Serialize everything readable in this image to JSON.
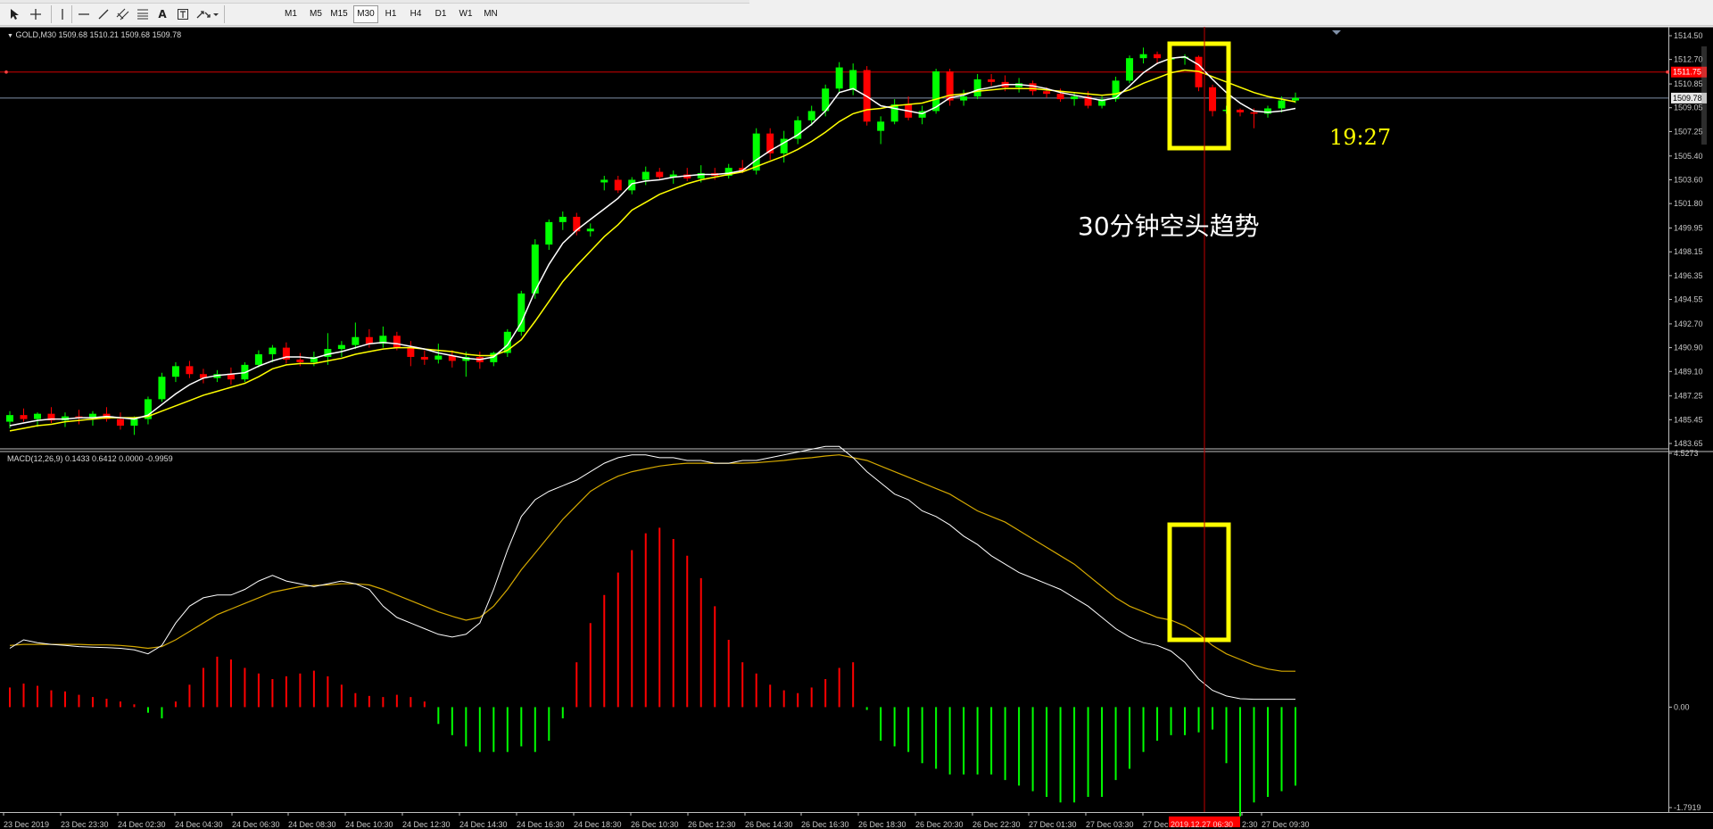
{
  "toolbar": {
    "tools": [
      "cursor-icon",
      "crosshair-icon",
      "vertical-line-icon",
      "horizontal-line-icon",
      "trendline-icon",
      "channel-icon",
      "fibonacci-icon",
      "text-icon",
      "text-label-icon",
      "arrows-icon"
    ],
    "text_tool_label": "A",
    "timeframes": [
      "M1",
      "M5",
      "M15",
      "M30",
      "H1",
      "H4",
      "D1",
      "W1",
      "MN"
    ],
    "active_timeframe": "M30"
  },
  "chart_header": {
    "label": "GOLD,M30  1509.68 1510.21 1509.68 1509.78"
  },
  "macd_header": {
    "label": "MACD(12,26,9) 0.1433 0.6412 0.0000 -0.9959"
  },
  "price_axis": [
    "1514.50",
    "1512.70",
    "1510.85",
    "1509.05",
    "1507.25",
    "1505.40",
    "1503.60",
    "1501.80",
    "1499.95",
    "1498.15",
    "1496.35",
    "1494.55",
    "1492.70",
    "1490.90",
    "1489.10",
    "1487.25",
    "1485.45",
    "1483.65"
  ],
  "current_price_tag": "1509.78",
  "red_line_tag": "1511.75",
  "macd_axis": [
    "4.5273",
    "0.00",
    "-1.7919"
  ],
  "time_axis": [
    "23 Dec 2019",
    "23 Dec 23:30",
    "24 Dec 02:30",
    "24 Dec 04:30",
    "24 Dec 06:30",
    "24 Dec 08:30",
    "24 Dec 10:30",
    "24 Dec 12:30",
    "24 Dec 14:30",
    "24 Dec 16:30",
    "24 Dec 18:30",
    "26 Dec 10:30",
    "26 Dec 12:30",
    "26 Dec 14:30",
    "26 Dec 16:30",
    "26 Dec 18:30",
    "26 Dec 20:30",
    "26 Dec 22:30",
    "27 Dec 01:30",
    "27 Dec 03:30",
    "27 Dec",
    "2:30",
    "27 Dec 09:30"
  ],
  "cursor_time_tag": "2019.12.27 06:30",
  "countdown": "19:27",
  "annotation": "30分钟空头趋势",
  "colors": {
    "bull": "#00ff00",
    "bear": "#ff0000",
    "ma_fast": "#ffffff",
    "ma_slow": "#ffff00",
    "highlight": "#ffff00",
    "grid_text": "#c8c8c8"
  },
  "chart_data": {
    "type": "candlestick",
    "symbol": "GOLD",
    "timeframe": "M30",
    "ylim": [
      1483.65,
      1514.5
    ],
    "candles": [
      {
        "o": 1485.3,
        "h": 1486.1,
        "l": 1484.8,
        "c": 1485.8
      },
      {
        "o": 1485.8,
        "h": 1486.3,
        "l": 1485.3,
        "c": 1485.5
      },
      {
        "o": 1485.5,
        "h": 1486.0,
        "l": 1484.9,
        "c": 1485.9
      },
      {
        "o": 1485.9,
        "h": 1486.4,
        "l": 1485.2,
        "c": 1485.4
      },
      {
        "o": 1485.4,
        "h": 1486.0,
        "l": 1484.9,
        "c": 1485.7
      },
      {
        "o": 1485.7,
        "h": 1486.2,
        "l": 1485.1,
        "c": 1485.6
      },
      {
        "o": 1485.6,
        "h": 1486.1,
        "l": 1485.0,
        "c": 1485.9
      },
      {
        "o": 1485.9,
        "h": 1486.4,
        "l": 1485.3,
        "c": 1485.5
      },
      {
        "o": 1485.5,
        "h": 1486.0,
        "l": 1484.7,
        "c": 1485.0
      },
      {
        "o": 1485.0,
        "h": 1485.7,
        "l": 1484.3,
        "c": 1485.5
      },
      {
        "o": 1485.5,
        "h": 1487.2,
        "l": 1485.1,
        "c": 1487.0
      },
      {
        "o": 1487.0,
        "h": 1489.0,
        "l": 1486.8,
        "c": 1488.7
      },
      {
        "o": 1488.7,
        "h": 1489.8,
        "l": 1488.3,
        "c": 1489.5
      },
      {
        "o": 1489.5,
        "h": 1489.9,
        "l": 1488.6,
        "c": 1488.9
      },
      {
        "o": 1488.9,
        "h": 1489.3,
        "l": 1488.2,
        "c": 1488.6
      },
      {
        "o": 1488.6,
        "h": 1489.2,
        "l": 1488.3,
        "c": 1488.9
      },
      {
        "o": 1488.9,
        "h": 1489.4,
        "l": 1488.1,
        "c": 1488.5
      },
      {
        "o": 1488.5,
        "h": 1489.8,
        "l": 1488.3,
        "c": 1489.6
      },
      {
        "o": 1489.6,
        "h": 1490.7,
        "l": 1489.4,
        "c": 1490.4
      },
      {
        "o": 1490.4,
        "h": 1491.1,
        "l": 1489.8,
        "c": 1490.9
      },
      {
        "o": 1490.9,
        "h": 1491.3,
        "l": 1489.7,
        "c": 1490.0
      },
      {
        "o": 1490.0,
        "h": 1490.5,
        "l": 1489.5,
        "c": 1489.8
      },
      {
        "o": 1489.8,
        "h": 1490.6,
        "l": 1489.5,
        "c": 1490.2
      },
      {
        "o": 1490.2,
        "h": 1492.0,
        "l": 1489.6,
        "c": 1490.8
      },
      {
        "o": 1490.8,
        "h": 1491.4,
        "l": 1490.2,
        "c": 1491.1
      },
      {
        "o": 1491.1,
        "h": 1492.8,
        "l": 1490.8,
        "c": 1491.7
      },
      {
        "o": 1491.7,
        "h": 1492.3,
        "l": 1490.9,
        "c": 1491.2
      },
      {
        "o": 1491.2,
        "h": 1492.5,
        "l": 1490.9,
        "c": 1491.8
      },
      {
        "o": 1491.8,
        "h": 1492.1,
        "l": 1490.7,
        "c": 1490.9
      },
      {
        "o": 1490.9,
        "h": 1491.4,
        "l": 1489.5,
        "c": 1490.2
      },
      {
        "o": 1490.2,
        "h": 1490.7,
        "l": 1489.6,
        "c": 1490.0
      },
      {
        "o": 1490.0,
        "h": 1491.2,
        "l": 1489.7,
        "c": 1490.3
      },
      {
        "o": 1490.3,
        "h": 1490.7,
        "l": 1489.4,
        "c": 1489.9
      },
      {
        "o": 1489.9,
        "h": 1490.6,
        "l": 1488.7,
        "c": 1490.2
      },
      {
        "o": 1490.2,
        "h": 1490.6,
        "l": 1489.3,
        "c": 1489.8
      },
      {
        "o": 1489.8,
        "h": 1490.6,
        "l": 1489.5,
        "c": 1490.5
      },
      {
        "o": 1490.5,
        "h": 1492.3,
        "l": 1490.2,
        "c": 1492.1
      },
      {
        "o": 1492.1,
        "h": 1495.2,
        "l": 1491.8,
        "c": 1495.0
      },
      {
        "o": 1495.0,
        "h": 1499.1,
        "l": 1494.6,
        "c": 1498.7
      },
      {
        "o": 1498.7,
        "h": 1500.6,
        "l": 1498.3,
        "c": 1500.4
      },
      {
        "o": 1500.4,
        "h": 1501.2,
        "l": 1499.8,
        "c": 1500.8
      },
      {
        "o": 1500.8,
        "h": 1501.1,
        "l": 1499.4,
        "c": 1499.7
      },
      {
        "o": 1499.7,
        "h": 1500.3,
        "l": 1499.3,
        "c": 1499.9
      },
      {
        "o": 1503.4,
        "h": 1503.9,
        "l": 1502.8,
        "c": 1503.6
      },
      {
        "o": 1503.6,
        "h": 1503.9,
        "l": 1502.6,
        "c": 1502.8
      },
      {
        "o": 1502.8,
        "h": 1503.8,
        "l": 1502.5,
        "c": 1503.6
      },
      {
        "o": 1503.6,
        "h": 1504.6,
        "l": 1503.2,
        "c": 1504.2
      },
      {
        "o": 1504.2,
        "h": 1504.5,
        "l": 1503.6,
        "c": 1503.8
      },
      {
        "o": 1503.8,
        "h": 1504.3,
        "l": 1503.3,
        "c": 1504.0
      },
      {
        "o": 1504.0,
        "h": 1504.5,
        "l": 1503.5,
        "c": 1503.7
      },
      {
        "o": 1503.7,
        "h": 1504.7,
        "l": 1503.4,
        "c": 1504.1
      },
      {
        "o": 1504.1,
        "h": 1504.5,
        "l": 1503.6,
        "c": 1503.9
      },
      {
        "o": 1503.9,
        "h": 1504.8,
        "l": 1503.7,
        "c": 1504.5
      },
      {
        "o": 1504.5,
        "h": 1505.1,
        "l": 1504.1,
        "c": 1504.3
      },
      {
        "o": 1504.3,
        "h": 1507.5,
        "l": 1504.0,
        "c": 1507.1
      },
      {
        "o": 1507.1,
        "h": 1507.5,
        "l": 1505.1,
        "c": 1505.6
      },
      {
        "o": 1505.6,
        "h": 1507.3,
        "l": 1504.9,
        "c": 1506.7
      },
      {
        "o": 1506.7,
        "h": 1508.4,
        "l": 1506.3,
        "c": 1508.1
      },
      {
        "o": 1508.1,
        "h": 1509.2,
        "l": 1507.7,
        "c": 1508.8
      },
      {
        "o": 1508.8,
        "h": 1510.8,
        "l": 1508.4,
        "c": 1510.5
      },
      {
        "o": 1510.5,
        "h": 1512.5,
        "l": 1510.2,
        "c": 1512.1
      },
      {
        "o": 1510.4,
        "h": 1512.4,
        "l": 1510.0,
        "c": 1511.9
      },
      {
        "o": 1511.9,
        "h": 1512.2,
        "l": 1507.7,
        "c": 1508.0
      },
      {
        "o": 1507.3,
        "h": 1508.4,
        "l": 1506.3,
        "c": 1508.0
      },
      {
        "o": 1508.0,
        "h": 1509.7,
        "l": 1507.8,
        "c": 1509.3
      },
      {
        "o": 1509.3,
        "h": 1509.9,
        "l": 1508.1,
        "c": 1508.3
      },
      {
        "o": 1508.3,
        "h": 1509.2,
        "l": 1507.8,
        "c": 1508.8
      },
      {
        "o": 1508.8,
        "h": 1512.0,
        "l": 1508.6,
        "c": 1511.8
      },
      {
        "o": 1511.8,
        "h": 1512.0,
        "l": 1509.2,
        "c": 1509.6
      },
      {
        "o": 1509.6,
        "h": 1510.4,
        "l": 1509.2,
        "c": 1509.9
      },
      {
        "o": 1509.9,
        "h": 1511.6,
        "l": 1509.7,
        "c": 1511.2
      },
      {
        "o": 1511.2,
        "h": 1511.6,
        "l": 1510.7,
        "c": 1511.0
      },
      {
        "o": 1511.0,
        "h": 1511.5,
        "l": 1510.3,
        "c": 1510.6
      },
      {
        "o": 1510.6,
        "h": 1511.3,
        "l": 1510.2,
        "c": 1510.9
      },
      {
        "o": 1510.9,
        "h": 1511.1,
        "l": 1510.0,
        "c": 1510.3
      },
      {
        "o": 1510.3,
        "h": 1510.6,
        "l": 1509.8,
        "c": 1510.1
      },
      {
        "o": 1510.1,
        "h": 1510.5,
        "l": 1509.5,
        "c": 1509.7
      },
      {
        "o": 1509.7,
        "h": 1510.2,
        "l": 1509.2,
        "c": 1509.9
      },
      {
        "o": 1509.9,
        "h": 1510.3,
        "l": 1509.0,
        "c": 1509.2
      },
      {
        "o": 1509.2,
        "h": 1509.9,
        "l": 1509.0,
        "c": 1509.7
      },
      {
        "o": 1509.7,
        "h": 1511.4,
        "l": 1509.5,
        "c": 1511.1
      },
      {
        "o": 1511.1,
        "h": 1513.0,
        "l": 1510.9,
        "c": 1512.8
      },
      {
        "o": 1512.8,
        "h": 1513.6,
        "l": 1512.4,
        "c": 1513.1
      },
      {
        "o": 1513.1,
        "h": 1513.3,
        "l": 1512.4,
        "c": 1512.8
      },
      {
        "o": 1512.8,
        "h": 1513.1,
        "l": 1511.5,
        "c": 1512.8
      },
      {
        "o": 1512.8,
        "h": 1513.1,
        "l": 1512.3,
        "c": 1512.9
      },
      {
        "o": 1512.9,
        "h": 1513.0,
        "l": 1510.3,
        "c": 1510.6
      },
      {
        "o": 1510.6,
        "h": 1510.8,
        "l": 1508.4,
        "c": 1508.8
      },
      {
        "o": 1508.8,
        "h": 1509.2,
        "l": 1508.6,
        "c": 1508.9
      },
      {
        "o": 1508.9,
        "h": 1509.0,
        "l": 1508.4,
        "c": 1508.7
      },
      {
        "o": 1508.7,
        "h": 1509.0,
        "l": 1507.5,
        "c": 1508.6
      },
      {
        "o": 1508.6,
        "h": 1509.2,
        "l": 1508.3,
        "c": 1509.0
      },
      {
        "o": 1509.0,
        "h": 1509.9,
        "l": 1508.7,
        "c": 1509.6
      },
      {
        "o": 1509.6,
        "h": 1510.2,
        "l": 1509.4,
        "c": 1509.8
      }
    ],
    "ma_fast": [
      1485.0,
      1485.2,
      1485.4,
      1485.5,
      1485.5,
      1485.6,
      1485.6,
      1485.7,
      1485.6,
      1485.5,
      1485.8,
      1486.6,
      1487.4,
      1488.1,
      1488.6,
      1488.8,
      1488.9,
      1489.0,
      1489.5,
      1489.9,
      1490.2,
      1490.2,
      1490.1,
      1490.4,
      1490.6,
      1490.9,
      1491.2,
      1491.3,
      1491.2,
      1491.0,
      1490.8,
      1490.5,
      1490.3,
      1490.1,
      1490.0,
      1490.2,
      1491.1,
      1492.8,
      1495.2,
      1497.2,
      1498.8,
      1499.8,
      1500.6,
      1501.4,
      1502.2,
      1503.3,
      1503.5,
      1503.6,
      1503.8,
      1503.9,
      1504.0,
      1504.0,
      1504.1,
      1504.3,
      1505.1,
      1505.8,
      1506.4,
      1507.0,
      1507.8,
      1508.8,
      1510.2,
      1510.5,
      1509.9,
      1509.2,
      1509.0,
      1508.8,
      1508.6,
      1509.1,
      1509.8,
      1510.0,
      1510.4,
      1510.6,
      1510.8,
      1510.8,
      1510.7,
      1510.5,
      1510.2,
      1510.0,
      1509.8,
      1509.6,
      1509.8,
      1510.7,
      1511.7,
      1512.4,
      1512.8,
      1512.9,
      1512.3,
      1511.2,
      1510.2,
      1509.4,
      1508.8,
      1508.7,
      1508.8,
      1509.0
    ],
    "ma_slow": [
      1484.6,
      1484.8,
      1485.0,
      1485.1,
      1485.3,
      1485.4,
      1485.5,
      1485.6,
      1485.6,
      1485.6,
      1485.7,
      1486.1,
      1486.5,
      1486.9,
      1487.3,
      1487.6,
      1487.9,
      1488.2,
      1488.7,
      1489.3,
      1489.6,
      1489.7,
      1489.7,
      1489.9,
      1490.1,
      1490.4,
      1490.6,
      1490.8,
      1490.9,
      1490.9,
      1490.8,
      1490.7,
      1490.6,
      1490.4,
      1490.3,
      1490.3,
      1490.7,
      1491.5,
      1492.9,
      1494.4,
      1495.9,
      1497.1,
      1498.2,
      1499.3,
      1500.2,
      1501.3,
      1501.9,
      1502.5,
      1502.9,
      1503.3,
      1503.6,
      1503.8,
      1504.0,
      1504.2,
      1504.6,
      1505.0,
      1505.4,
      1505.9,
      1506.5,
      1507.2,
      1508.0,
      1508.6,
      1508.9,
      1509.0,
      1509.2,
      1509.3,
      1509.4,
      1509.7,
      1510.0,
      1510.1,
      1510.3,
      1510.4,
      1510.5,
      1510.5,
      1510.5,
      1510.4,
      1510.3,
      1510.2,
      1510.1,
      1510.0,
      1510.1,
      1510.4,
      1510.9,
      1511.3,
      1511.7,
      1511.9,
      1511.8,
      1511.4,
      1511.0,
      1510.6,
      1510.2,
      1509.9,
      1509.7,
      1509.5
    ],
    "macd_ylim": [
      -1.7919,
      4.5273
    ],
    "macd_hist": [
      0.35,
      0.42,
      0.38,
      0.3,
      0.28,
      0.22,
      0.18,
      0.15,
      0.1,
      0.05,
      -0.1,
      -0.2,
      0.1,
      0.4,
      0.7,
      0.9,
      0.85,
      0.7,
      0.6,
      0.5,
      0.55,
      0.6,
      0.65,
      0.55,
      0.4,
      0.25,
      0.2,
      0.18,
      0.22,
      0.18,
      0.1,
      -0.3,
      -0.5,
      -0.7,
      -0.8,
      -0.8,
      -0.8,
      -0.7,
      -0.8,
      -0.6,
      -0.2,
      0.8,
      1.5,
      2.0,
      2.4,
      2.8,
      3.1,
      3.2,
      3.0,
      2.7,
      2.3,
      1.8,
      1.2,
      0.8,
      0.6,
      0.4,
      0.3,
      0.25,
      0.35,
      0.5,
      0.7,
      0.8,
      -0.05,
      -0.6,
      -0.7,
      -0.8,
      -1.0,
      -1.1,
      -1.2,
      -1.2,
      -1.2,
      -1.2,
      -1.3,
      -1.4,
      -1.5,
      -1.6,
      -1.7,
      -1.7,
      -1.6,
      -1.6,
      -1.3,
      -1.1,
      -0.8,
      -0.6,
      -0.5,
      -0.5,
      -0.45,
      -0.4,
      -1.0,
      -1.95,
      -1.7,
      -1.6,
      -1.5,
      -1.4
    ],
    "macd_line": [
      1.05,
      1.2,
      1.15,
      1.12,
      1.1,
      1.08,
      1.07,
      1.06,
      1.05,
      1.02,
      0.95,
      1.1,
      1.5,
      1.8,
      1.95,
      2.0,
      2.0,
      2.1,
      2.25,
      2.35,
      2.25,
      2.2,
      2.15,
      2.2,
      2.25,
      2.2,
      2.1,
      1.8,
      1.6,
      1.5,
      1.4,
      1.3,
      1.25,
      1.3,
      1.5,
      2.1,
      2.8,
      3.4,
      3.7,
      3.85,
      3.95,
      4.05,
      4.2,
      4.35,
      4.45,
      4.5,
      4.5,
      4.45,
      4.45,
      4.4,
      4.4,
      4.35,
      4.35,
      4.4,
      4.4,
      4.45,
      4.5,
      4.55,
      4.6,
      4.65,
      4.65,
      4.45,
      4.2,
      4.0,
      3.8,
      3.7,
      3.5,
      3.4,
      3.25,
      3.05,
      2.9,
      2.7,
      2.55,
      2.4,
      2.3,
      2.2,
      2.1,
      1.95,
      1.8,
      1.6,
      1.4,
      1.25,
      1.15,
      1.1,
      1.0,
      0.8,
      0.5,
      0.3,
      0.2,
      0.15,
      0.14,
      0.14,
      0.14,
      0.14
    ],
    "macd_signal": [
      1.1,
      1.12,
      1.12,
      1.12,
      1.12,
      1.12,
      1.11,
      1.11,
      1.1,
      1.08,
      1.05,
      1.08,
      1.2,
      1.35,
      1.5,
      1.65,
      1.75,
      1.85,
      1.95,
      2.05,
      2.1,
      2.15,
      2.17,
      2.18,
      2.2,
      2.2,
      2.18,
      2.1,
      2.0,
      1.9,
      1.8,
      1.7,
      1.62,
      1.55,
      1.6,
      1.8,
      2.1,
      2.45,
      2.75,
      3.05,
      3.35,
      3.6,
      3.85,
      4.0,
      4.12,
      4.2,
      4.25,
      4.3,
      4.33,
      4.35,
      4.35,
      4.35,
      4.35,
      4.35,
      4.36,
      4.38,
      4.4,
      4.43,
      4.45,
      4.48,
      4.5,
      4.45,
      4.4,
      4.3,
      4.2,
      4.1,
      4.0,
      3.9,
      3.8,
      3.65,
      3.5,
      3.4,
      3.3,
      3.15,
      3.0,
      2.85,
      2.7,
      2.55,
      2.35,
      2.15,
      1.95,
      1.8,
      1.7,
      1.6,
      1.55,
      1.45,
      1.3,
      1.1,
      0.95,
      0.85,
      0.75,
      0.68,
      0.64,
      0.64
    ]
  }
}
